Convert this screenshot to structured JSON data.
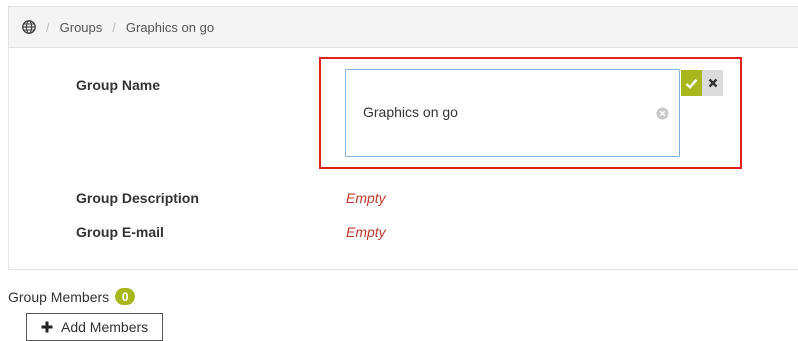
{
  "breadcrumb": {
    "home_icon": "globe-icon",
    "separator": "/",
    "items": [
      {
        "label": "Groups"
      },
      {
        "label": "Graphics on go"
      }
    ]
  },
  "form": {
    "group_name": {
      "label": "Group Name",
      "value": "Graphics on go"
    },
    "group_description": {
      "label": "Group Description",
      "value": "Empty"
    },
    "group_email": {
      "label": "Group E-mail",
      "value": "Empty"
    },
    "actions": {
      "confirm_icon": "check-icon",
      "cancel_icon": "close-icon"
    }
  },
  "members": {
    "title": "Group Members",
    "count": "0",
    "add_button_label": "Add Members",
    "add_icon": "plus-icon"
  },
  "colors": {
    "accent": "#a7b81e",
    "empty_value": "#c0392b",
    "highlight": "#e02020"
  }
}
